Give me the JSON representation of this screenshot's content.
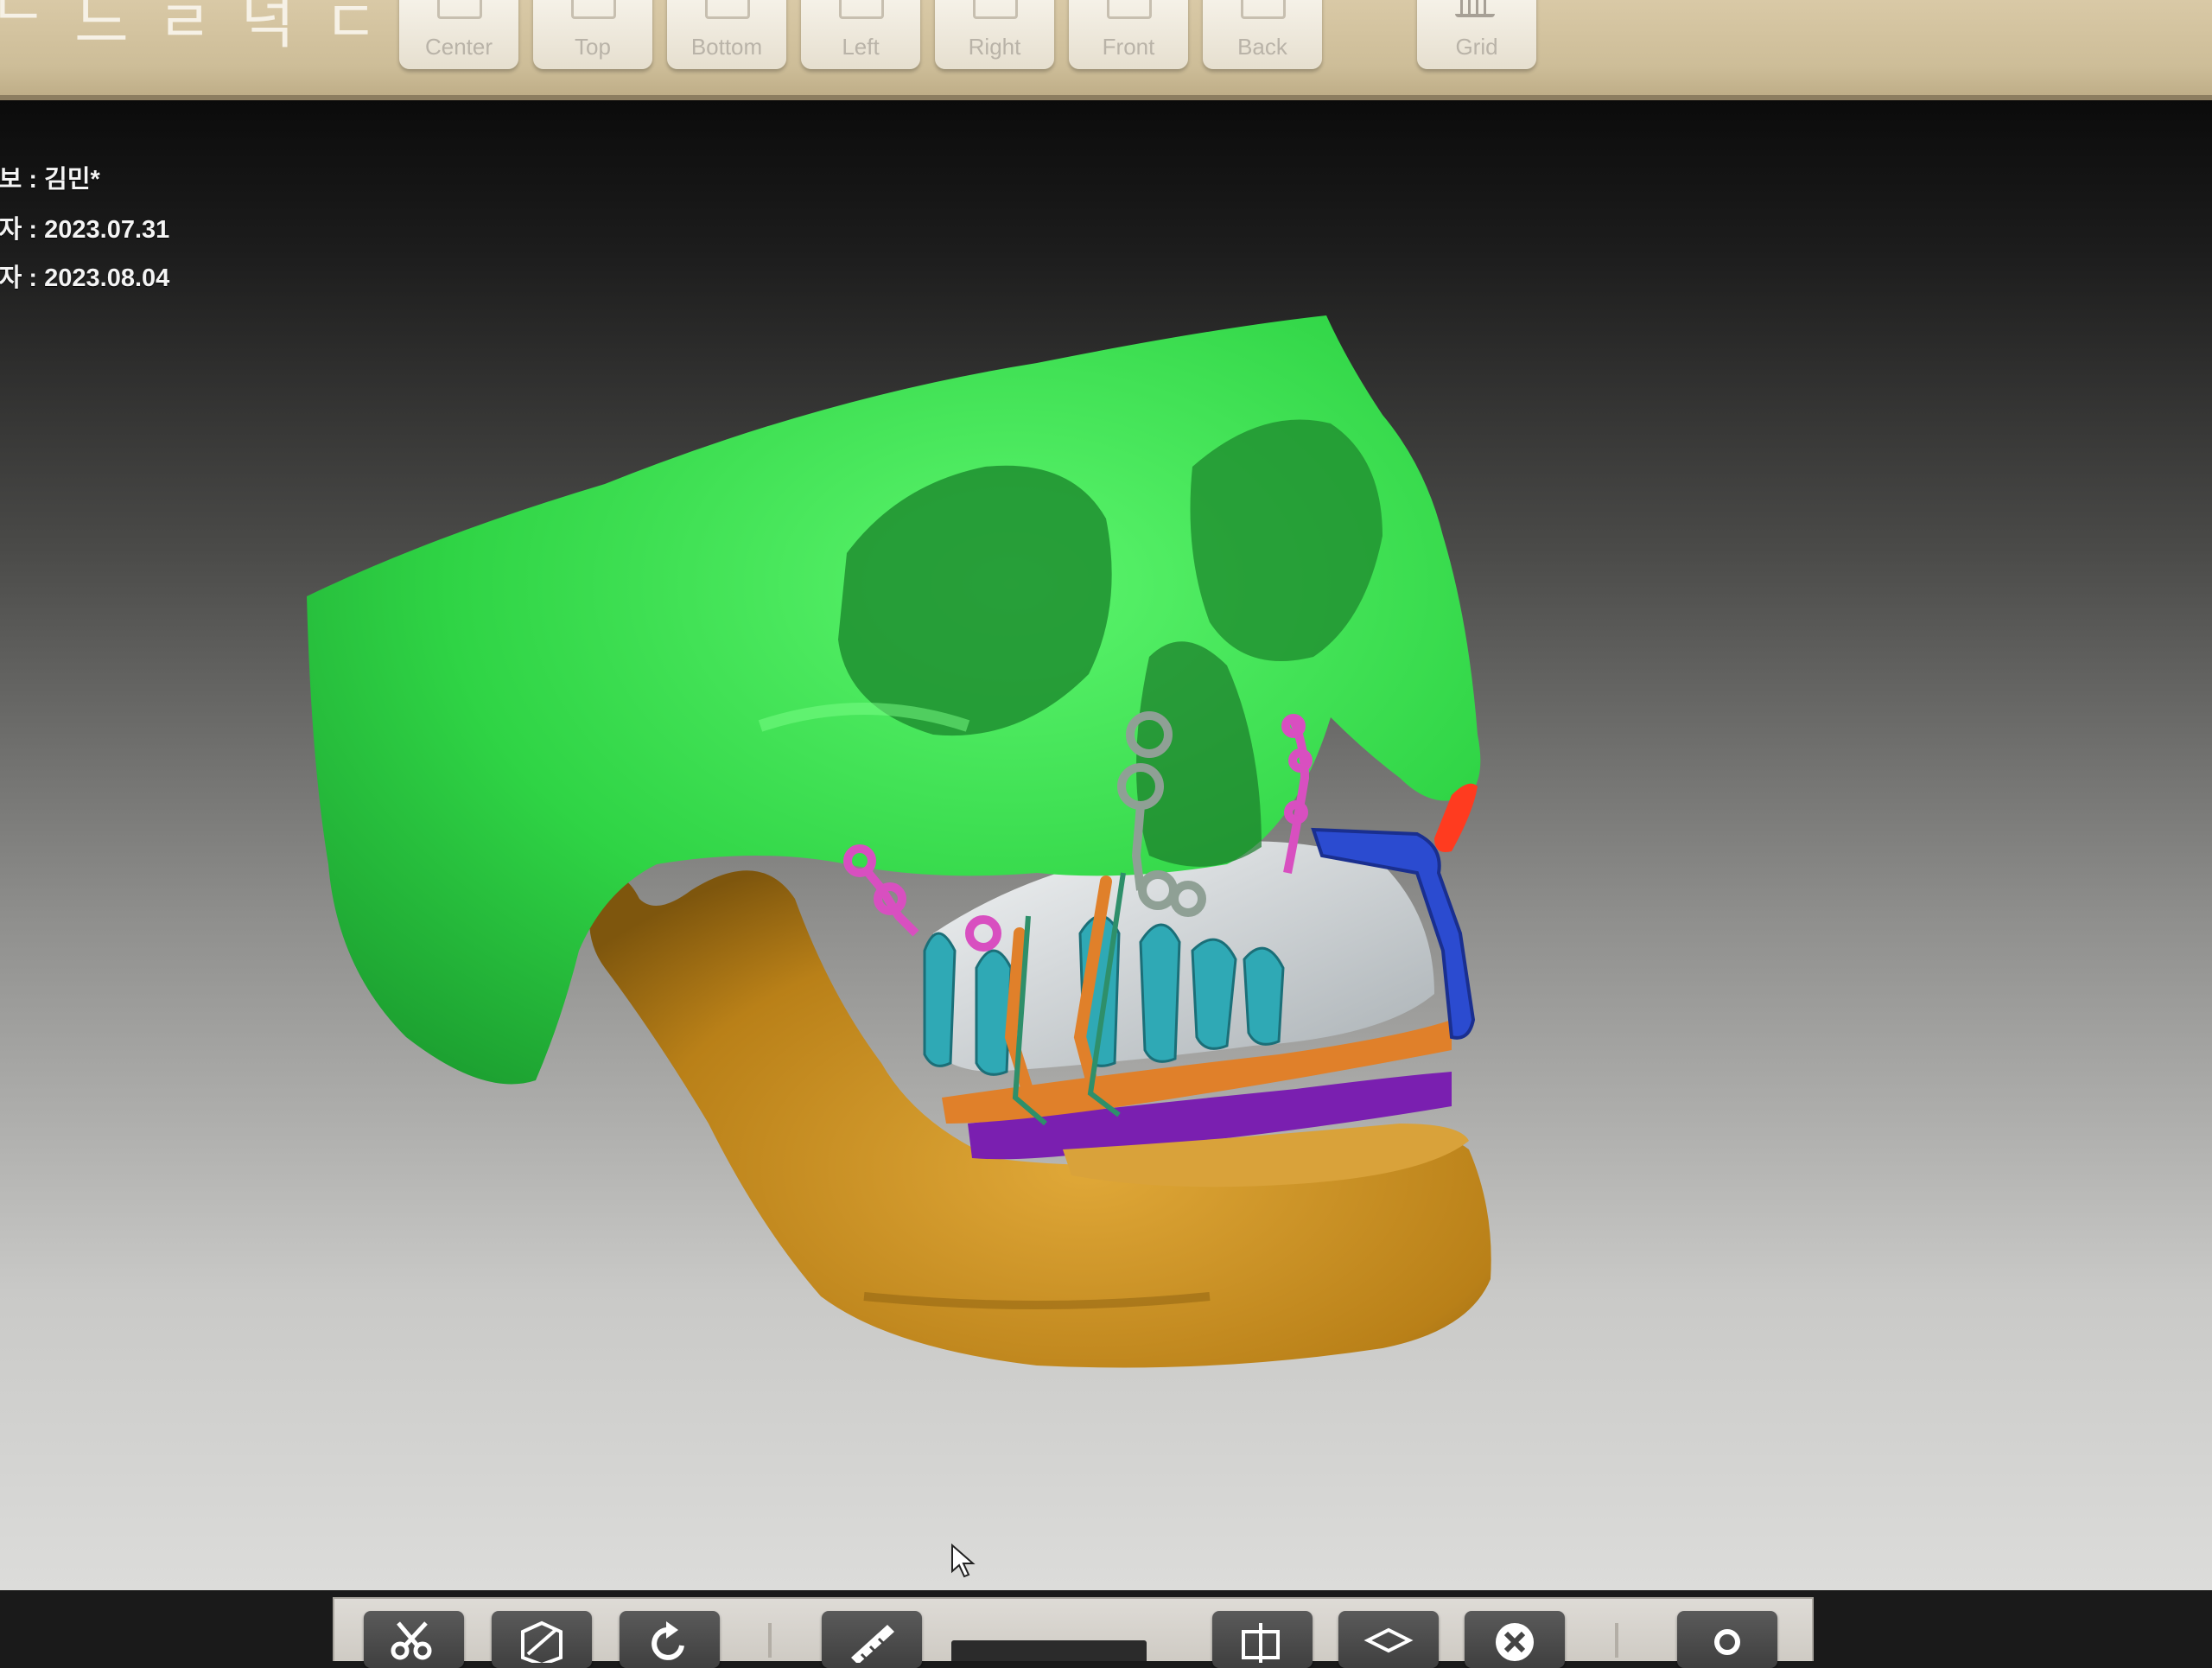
{
  "app": {
    "title_fragment": "ᄂ 느 ㄹ 넉 ㄷ"
  },
  "toolbar": {
    "views": [
      {
        "label": "Center"
      },
      {
        "label": "Top"
      },
      {
        "label": "Bottom"
      },
      {
        "label": "Left"
      },
      {
        "label": "Right"
      },
      {
        "label": "Front"
      },
      {
        "label": "Back"
      }
    ],
    "grid": {
      "label": "Grid"
    }
  },
  "patient_info": [
    {
      "label": "정보",
      "value": "김민*"
    },
    {
      "label": "일자",
      "value": "2023.07.31"
    },
    {
      "label": "일자",
      "value": "2023.08.04"
    }
  ],
  "info_separator": " : ",
  "model": {
    "description": "3D skull model with surgical plates",
    "colors": {
      "maxilla_skull": "#33e04a",
      "mandible": "#c08a1e",
      "teeth_upper": "#d9dde0",
      "teeth_cyan": "#2fa9b5",
      "splint_orange": "#e0802a",
      "splint_purple": "#7a1fb0",
      "plate_magenta": "#d84fc0",
      "plate_gray": "#9aa8a0",
      "wire_blue": "#2b4bd0",
      "accent_red": "#ff3b1f"
    }
  },
  "bottom_toolbar": {
    "tools": [
      {
        "icon": "scissors-icon"
      },
      {
        "icon": "mirror-cube-icon"
      },
      {
        "icon": "rotate-icon"
      },
      {
        "icon": "ruler-icon"
      },
      {
        "icon": "section-icon"
      },
      {
        "icon": "layer-icon"
      },
      {
        "icon": "close-circle-icon"
      },
      {
        "icon": "settings-icon"
      }
    ]
  }
}
